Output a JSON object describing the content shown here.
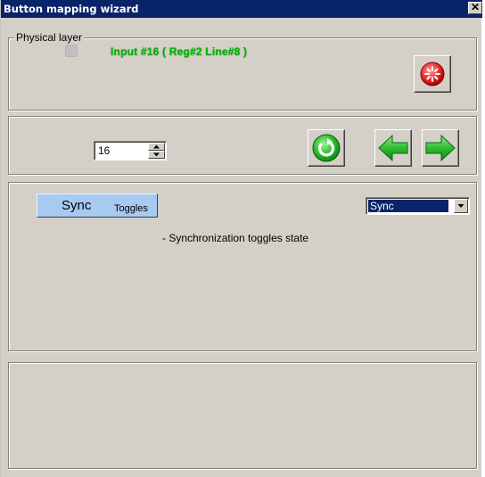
{
  "window": {
    "title": "Button mapping wizard",
    "close_glyph": "✕"
  },
  "physical_layer": {
    "legend": "Physical layer",
    "input_status": "Input #16  ( Reg#2   Line#8 )",
    "status_color": "#08b808",
    "reset_icon": "red-burst-icon"
  },
  "navigation": {
    "button_number": "16",
    "refresh_icon": "green-refresh-icon",
    "prev_icon": "green-left-arrow-icon",
    "next_icon": "green-right-arrow-icon"
  },
  "mapping": {
    "button_label_main": "Sync",
    "button_label_sub": "Toggles",
    "description": "- Synchronization toggles state",
    "mode_selected": "Sync"
  },
  "colors": {
    "title_bar": "#0a246a",
    "face": "#d4d0c8",
    "sync_button": "#a6caf0"
  }
}
